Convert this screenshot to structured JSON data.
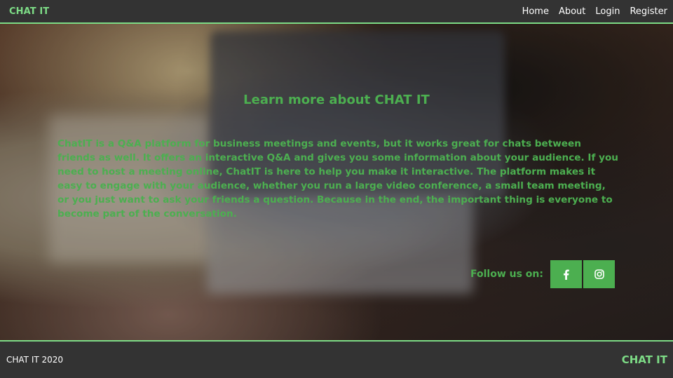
{
  "navbar": {
    "brand": "CHAT IT",
    "links": [
      {
        "label": "Home"
      },
      {
        "label": "About"
      },
      {
        "label": "Login"
      },
      {
        "label": "Register"
      }
    ]
  },
  "hero": {
    "title": "Learn more about CHAT IT",
    "description": "ChatIT is a Q&A platform for business meetings and events, but it works great for chats between friends as well. It offers an interactive Q&A and gives you some information about your audience. If you need to host a meeting online, ChatIT is here to help you make it interactive. The platform makes it easy to engage with your audience, whether you run a large video conference, a small team meeting, or you just want to ask your friends a question. Because in the end, the important thing is everyone to become part of the conversation.",
    "follow_label": "Follow us on:",
    "social": [
      {
        "icon": "facebook-icon"
      },
      {
        "icon": "instagram-icon"
      }
    ]
  },
  "footer": {
    "copyright": "CHAT IT 2020",
    "brand": "CHAT IT"
  },
  "colors": {
    "accent": "#4caf50",
    "accent_light": "#7ddc86",
    "bar_background": "#333333"
  }
}
